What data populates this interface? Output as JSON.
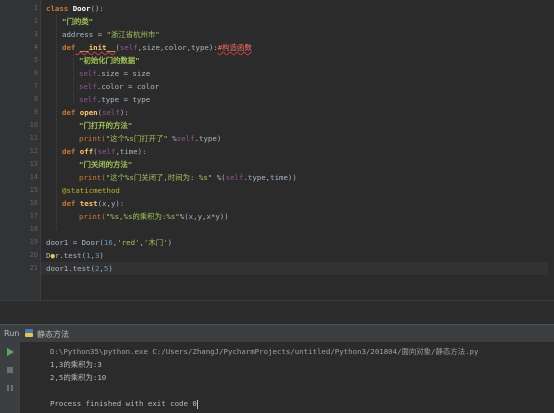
{
  "editor": {
    "line_numbers": [
      "1",
      "2",
      "3",
      "4",
      "5",
      "6",
      "7",
      "8",
      "9",
      "10",
      "11",
      "12",
      "13",
      "14",
      "15",
      "16",
      "17",
      "18",
      "19",
      "20",
      "21"
    ],
    "tokens": {
      "l1": [
        "class",
        " Door",
        "():"
      ],
      "l2": [
        "\"门的类\""
      ],
      "l3": [
        "address = ",
        "\"浙江省杭州市\""
      ],
      "l4": [
        "def",
        " __init__",
        "(",
        "self",
        ",size,color,type):",
        "#构造函数"
      ],
      "l5": [
        "\"初始化门的数据\""
      ],
      "l6": [
        "self",
        ".size = size"
      ],
      "l7": [
        "self",
        ".color = color"
      ],
      "l8": [
        "self",
        ".type = type"
      ],
      "l9": [
        "def",
        " open",
        "(",
        "self",
        "):"
      ],
      "l10": [
        "\"门打开的方法\""
      ],
      "l11": [
        "print(",
        "\"这个%s门打开了\"",
        " %",
        "self",
        ".type)"
      ],
      "l12": [
        "def",
        " off",
        "(",
        "self",
        ",time):"
      ],
      "l13": [
        "\"门关闭的方法\""
      ],
      "l14": [
        "print(",
        "\"这个%s门关闭了,时间为: %s\"",
        " %(",
        "self",
        ".type,time))"
      ],
      "l15": [
        "@staticmethod"
      ],
      "l16": [
        "def",
        " test",
        "(x,y):"
      ],
      "l17": [
        "print(",
        "\"%s,%s的乘积为:%s\"",
        "%(x,y,x*y))"
      ],
      "l19": [
        "door1 = Door(",
        "16",
        ",",
        "'red'",
        ",",
        "'木门'",
        ")"
      ],
      "l20": [
        "D",
        "r.test(",
        "1",
        ",",
        "3",
        ")"
      ],
      "l21": [
        "door1.test(",
        "2",
        ",",
        "5",
        ")"
      ]
    }
  },
  "run_panel": {
    "tab_label": "Run",
    "config_name": "静态方法",
    "console_lines": [
      "D:\\Python35\\python.exe C:/Users/ZhangJ/PycharmProjects/untitled/Python3/201804/面向对象/静态方法.py",
      "1,3的乘积为:3",
      "2,5的乘积为:10",
      "",
      "Process finished with exit code 0"
    ]
  },
  "colors": {
    "background": "#2b2b2b",
    "keyword": "#cc7832",
    "string": "#a5c25c",
    "self": "#94558d",
    "number": "#6897bb",
    "decorator": "#bbb529",
    "run_green": "#59a869"
  }
}
